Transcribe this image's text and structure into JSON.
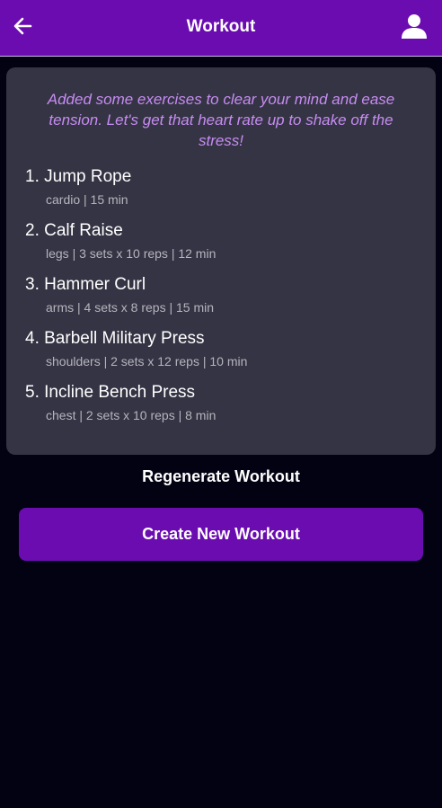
{
  "header": {
    "title": "Workout",
    "back_icon": "arrow-left-icon",
    "profile_icon": "user-icon"
  },
  "colors": {
    "accent": "#6a0cb0",
    "background": "#020212",
    "card": "#353444",
    "intro_text": "#c68cf2",
    "meta_text": "#b5b4bd"
  },
  "workout": {
    "intro": "Added some exercises to clear your mind and ease tension. Let's get that heart rate up to shake off the stress!",
    "exercises": [
      {
        "name": "1. Jump Rope",
        "details": "cardio | 15 min"
      },
      {
        "name": "2. Calf Raise",
        "details": "legs | 3 sets x 10 reps | 12 min"
      },
      {
        "name": "3. Hammer Curl",
        "details": "arms | 4 sets x 8 reps | 15 min"
      },
      {
        "name": "4. Barbell Military Press",
        "details": "shoulders | 2 sets x 12 reps | 10 min"
      },
      {
        "name": "5. Incline Bench Press",
        "details": "chest | 2 sets x 10 reps | 8 min"
      }
    ]
  },
  "actions": {
    "regenerate_label": "Regenerate Workout",
    "create_label": "Create New Workout"
  }
}
